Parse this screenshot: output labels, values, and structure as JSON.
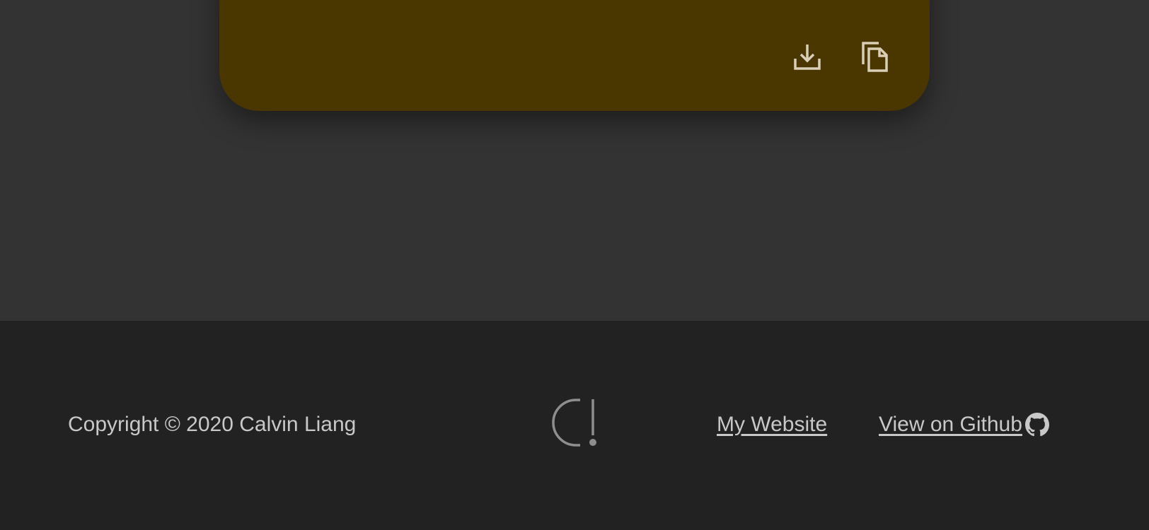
{
  "card": {
    "background_color": "#4a3700",
    "icon_color": "#d9cfb8",
    "actions": [
      {
        "icon": "download-icon"
      },
      {
        "icon": "copy-icon"
      }
    ]
  },
  "footer": {
    "copyright": "Copyright © 2020 Calvin Liang",
    "logo_icon": "logo-icon",
    "links": {
      "website": "My Website",
      "github": "View on Github "
    },
    "github_icon": "github-icon"
  },
  "colors": {
    "page_bg": "#333333",
    "footer_bg": "#222222",
    "footer_text": "#c8c8c8"
  }
}
